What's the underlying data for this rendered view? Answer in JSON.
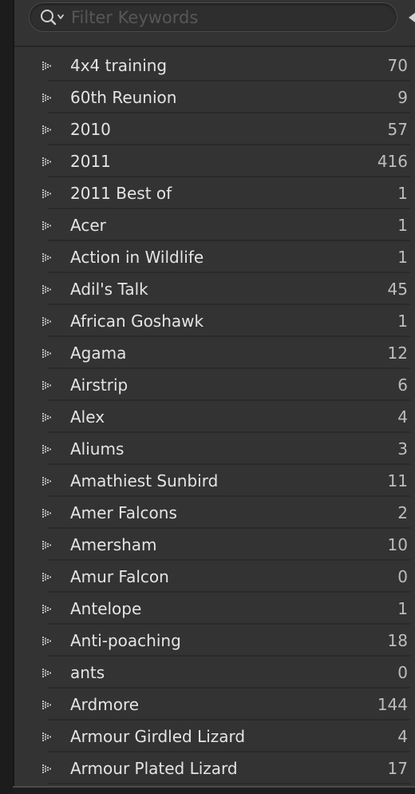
{
  "filter": {
    "placeholder": "Filter Keywords",
    "value": ""
  },
  "icons": {
    "search": "search-icon",
    "search_dropdown": "chevron-down-icon",
    "collapse": "triangle-left-icon",
    "expand": "dotted-triangle-right-icon"
  },
  "colors": {
    "panel_bg": "#333333",
    "text": "#e4e4e4",
    "count_text": "#bdbdbd"
  },
  "keywords": [
    {
      "label": "4x4 training",
      "count": "70"
    },
    {
      "label": "60th Reunion",
      "count": "9"
    },
    {
      "label": "2010",
      "count": "57"
    },
    {
      "label": "2011",
      "count": "416"
    },
    {
      "label": "2011 Best of",
      "count": "1"
    },
    {
      "label": "Acer",
      "count": "1"
    },
    {
      "label": "Action in Wildlife",
      "count": "1"
    },
    {
      "label": "Adil's Talk",
      "count": "45"
    },
    {
      "label": "African Goshawk",
      "count": "1"
    },
    {
      "label": "Agama",
      "count": "12"
    },
    {
      "label": "Airstrip",
      "count": "6"
    },
    {
      "label": "Alex",
      "count": "4"
    },
    {
      "label": "Aliums",
      "count": "3"
    },
    {
      "label": "Amathiest Sunbird",
      "count": "11"
    },
    {
      "label": "Amer Falcons",
      "count": "2"
    },
    {
      "label": "Amersham",
      "count": "10"
    },
    {
      "label": "Amur Falcon",
      "count": "0"
    },
    {
      "label": "Antelope",
      "count": "1"
    },
    {
      "label": "Anti-poaching",
      "count": "18"
    },
    {
      "label": "ants",
      "count": "0"
    },
    {
      "label": "Ardmore",
      "count": "144"
    },
    {
      "label": "Armour Girdled Lizard",
      "count": "4"
    },
    {
      "label": "Armour Plated Lizard",
      "count": "17"
    }
  ]
}
